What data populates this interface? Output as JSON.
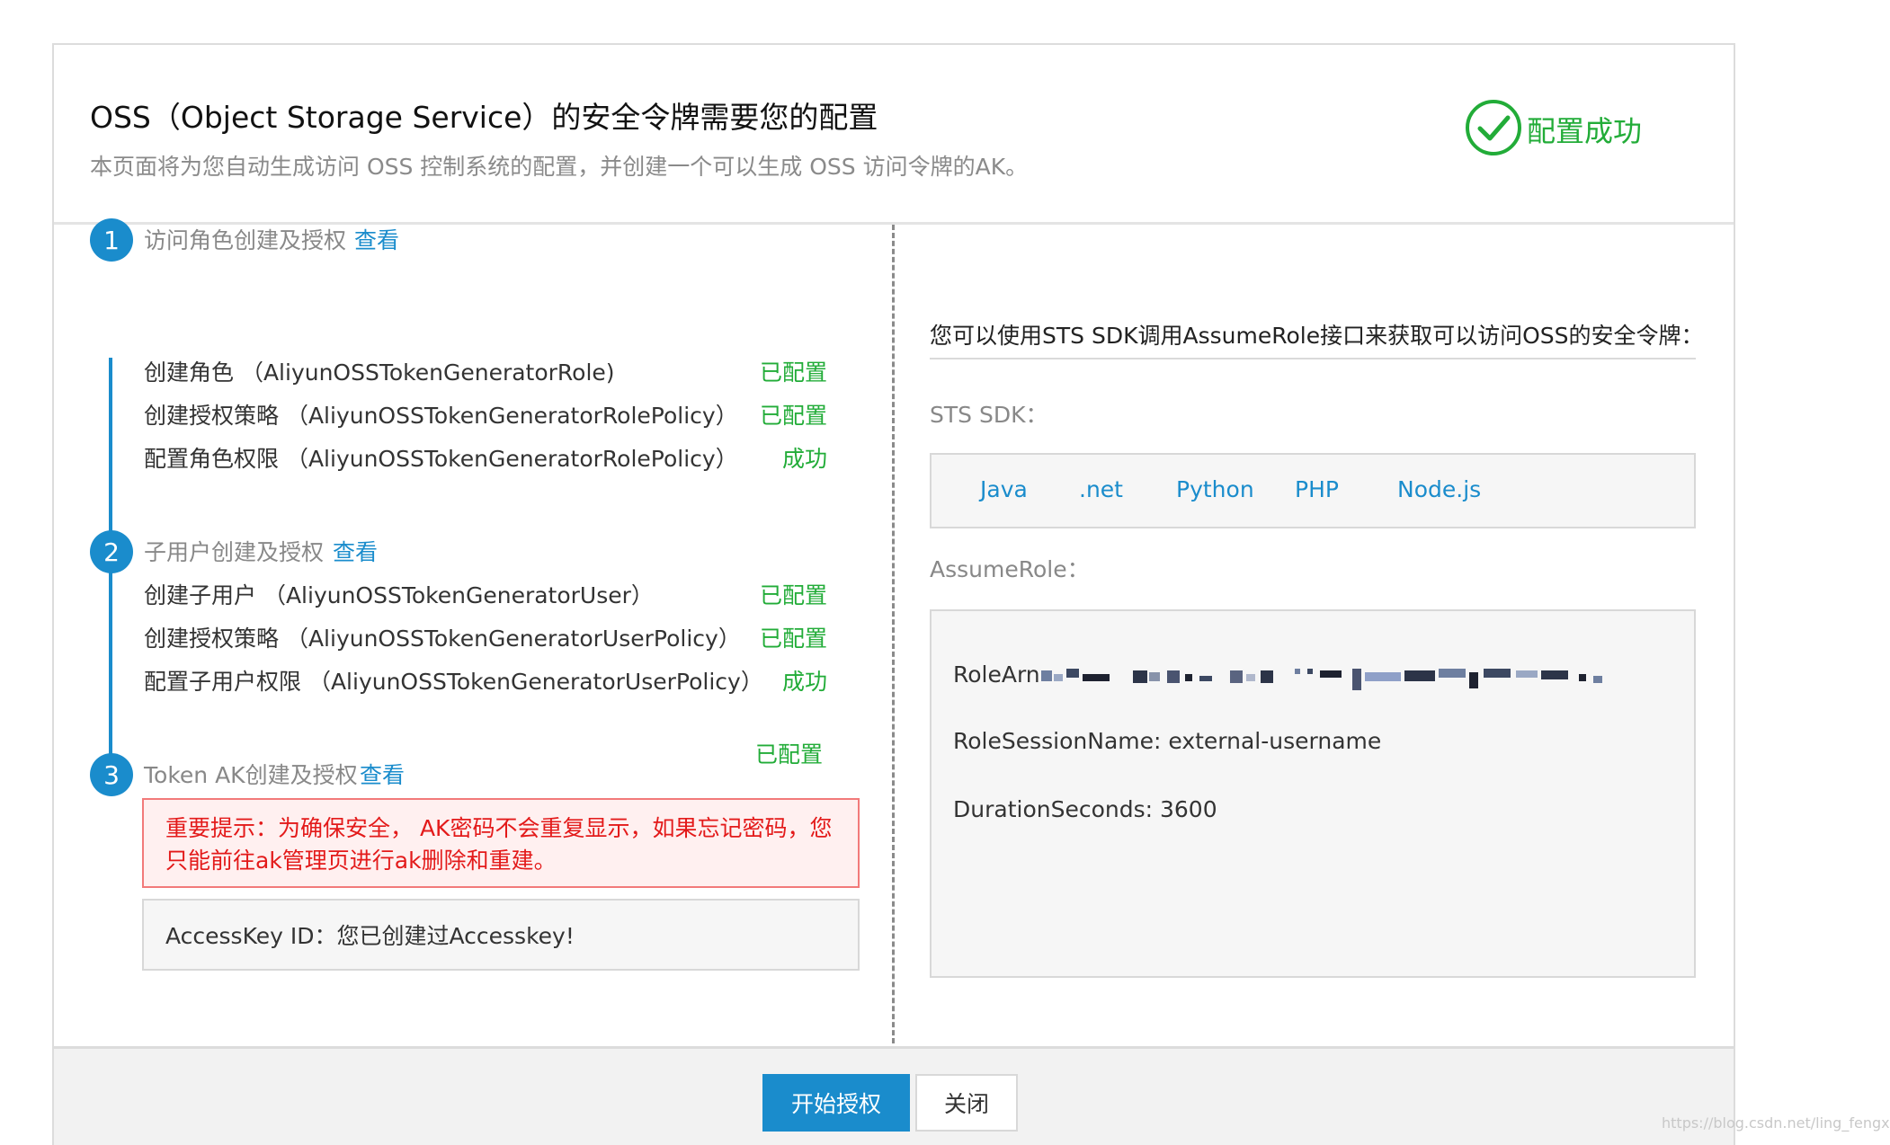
{
  "header": {
    "title": "OSS（Object Storage Service）的安全令牌需要您的配置",
    "subtitle": "本页面将为您自动生成访问 OSS 控制系统的配置，并创建一个可以生成 OSS 访问令牌的AK。",
    "status_text": "配置成功",
    "status_color": "#22ac38"
  },
  "steps": [
    {
      "number": "1",
      "title": "访问角色创建及授权",
      "link": "查看",
      "items": [
        {
          "name": "创建角色 （AliyunOSSTokenGeneratorRole)",
          "status": "已配置"
        },
        {
          "name": "创建授权策略 （AliyunOSSTokenGeneratorRolePolicy）",
          "status": "已配置"
        },
        {
          "name": "配置角色权限 （AliyunOSSTokenGeneratorRolePolicy）",
          "status": "成功"
        }
      ]
    },
    {
      "number": "2",
      "title": "子用户创建及授权",
      "link": "查看",
      "items": [
        {
          "name": "创建子用户 （AliyunOSSTokenGeneratorUser）",
          "status": "已配置"
        },
        {
          "name": "创建授权策略 （AliyunOSSTokenGeneratorUserPolicy）",
          "status": "已配置"
        },
        {
          "name": "配置子用户权限 （AliyunOSSTokenGeneratorUserPolicy）",
          "status": "成功"
        }
      ]
    },
    {
      "number": "3",
      "title": "Token AK创建及授权",
      "link": "查看",
      "status": "已配置"
    }
  ],
  "warning": "重要提示：为确保安全， AK密码不会重复显示，如果忘记密码，您只能前往ak管理页进行ak删除和重建。",
  "accesskey": "AccessKey ID：您已创建过Accesskey!",
  "right": {
    "intro": "您可以使用STS SDK调用AssumeRole接口来获取可以访问OSS的安全令牌：",
    "sdk_label": "STS SDK：",
    "sdk_links": [
      "Java",
      ".net",
      "Python",
      "PHP",
      "Node.js"
    ],
    "assume_label": "AssumeRole：",
    "role_arn_label": "RoleArn",
    "role_session_name": "RoleSessionName: external-username",
    "duration_seconds": "DurationSeconds: 3600"
  },
  "footer": {
    "primary_button": "开始授权",
    "secondary_button": "关闭"
  },
  "watermark": "https://blog.csdn.net/ling_fengxue",
  "colors": {
    "accent": "#1a8ccc",
    "success": "#22ac38",
    "error": "#e31a1a"
  },
  "icons": {
    "status": "check-circle-icon"
  }
}
